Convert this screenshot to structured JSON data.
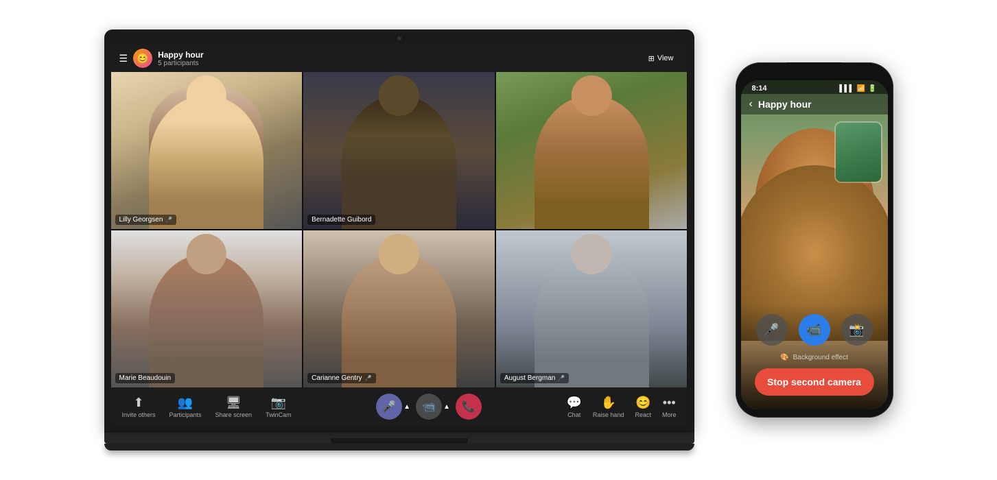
{
  "laptop": {
    "header": {
      "menu_icon": "☰",
      "emoji": "😊",
      "meeting_title": "Happy hour",
      "participants": "5 participants",
      "view_icon": "⊞",
      "view_label": "View"
    },
    "participants": [
      {
        "id": "lilly",
        "name": "Lilly Georgsen",
        "mic": true,
        "position": "top-left"
      },
      {
        "id": "bernadette",
        "name": "Bernadette Guibord",
        "mic": false,
        "position": "top-mid"
      },
      {
        "id": "dog",
        "name": "",
        "mic": false,
        "position": "top-right"
      },
      {
        "id": "marie",
        "name": "Marie Beaudouin",
        "mic": false,
        "position": "bot-left"
      },
      {
        "id": "carianne",
        "name": "Carianne Gentry",
        "mic": true,
        "position": "bot-mid"
      },
      {
        "id": "august",
        "name": "August Bergman",
        "mic": true,
        "position": "bot-right"
      }
    ],
    "toolbar": {
      "invite_label": "Invite others",
      "participants_label": "Participants",
      "share_label": "Share screen",
      "twincam_label": "TwinCam",
      "chat_label": "Chat",
      "raise_label": "Raise hand",
      "react_label": "React",
      "more_label": "More"
    }
  },
  "phone": {
    "status_bar": {
      "time": "8:14",
      "signal": "▌▌▌",
      "wifi": "WiFi",
      "battery": "🔋"
    },
    "header": {
      "back_icon": "‹",
      "title": "Happy hour"
    },
    "controls": {
      "bg_effect_label": "Background effect",
      "stop_camera_btn": "Stop second camera"
    }
  }
}
